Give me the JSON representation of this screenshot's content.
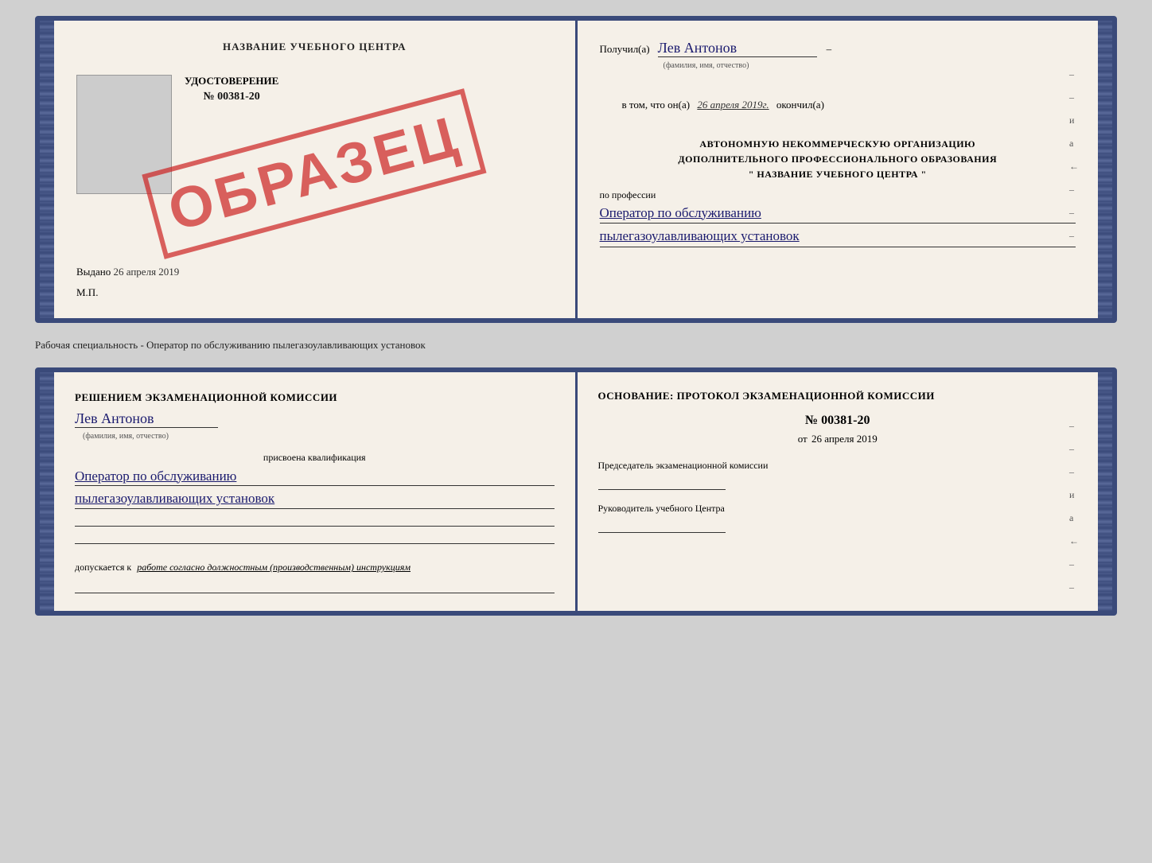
{
  "cert1": {
    "left": {
      "title": "НАЗВАНИЕ УЧЕБНОГО ЦЕНТРА",
      "doc_type": "УДОСТОВЕРЕНИЕ",
      "doc_number": "№ 00381-20",
      "issued_label": "Выдано",
      "issued_date": "26 апреля 2019",
      "mp_label": "М.П.",
      "stamp_text": "ОБРАЗЕЦ"
    },
    "right": {
      "received_label": "Получил(а)",
      "name_handwritten": "Лев Антонов",
      "fio_hint": "(фамилия, имя, отчество)",
      "date_prefix": "в том, что он(а)",
      "date_handwritten": "26 апреля 2019г.",
      "date_suffix": "окончил(а)",
      "org_line1": "АВТОНОМНУЮ НЕКОММЕРЧЕСКУЮ ОРГАНИЗАЦИЮ",
      "org_line2": "ДОПОЛНИТЕЛЬНОГО ПРОФЕССИОНАЛЬНОГО ОБРАЗОВАНИЯ",
      "org_line3": "\"  НАЗВАНИЕ УЧЕБНОГО ЦЕНТРА  \"",
      "profession_label": "по профессии",
      "profession_line1": "Оператор по обслуживанию",
      "profession_line2": "пылегазоулавливающих установок",
      "edge_marks": [
        "-",
        "-",
        "и",
        "а",
        "←",
        "-",
        "-",
        "-"
      ]
    }
  },
  "middle_label": "Рабочая специальность - Оператор по обслуживанию пылегазоулавливающих установок",
  "cert2": {
    "left": {
      "commission_text": "Решением экзаменационной комиссии",
      "name_handwritten": "Лев Антонов",
      "fio_hint": "(фамилия, имя, отчество)",
      "qualification_label": "присвоена квалификация",
      "qual_line1": "Оператор по обслуживанию",
      "qual_line2": "пылегазоулавливающих установок",
      "допускается_prefix": "допускается к",
      "допускается_text": "работе согласно должностным (производственным) инструкциям"
    },
    "right": {
      "osnov_label": "Основание: протокол экзаменационной комиссии",
      "protocol_number": "№  00381-20",
      "protocol_date_prefix": "от",
      "protocol_date": "26 апреля 2019",
      "chairman_label": "Председатель экзаменационной комиссии",
      "head_label": "Руководитель учебного Центра",
      "edge_marks": [
        "-",
        "-",
        "-",
        "и",
        "а",
        "←",
        "-",
        "-",
        "-"
      ]
    }
  }
}
